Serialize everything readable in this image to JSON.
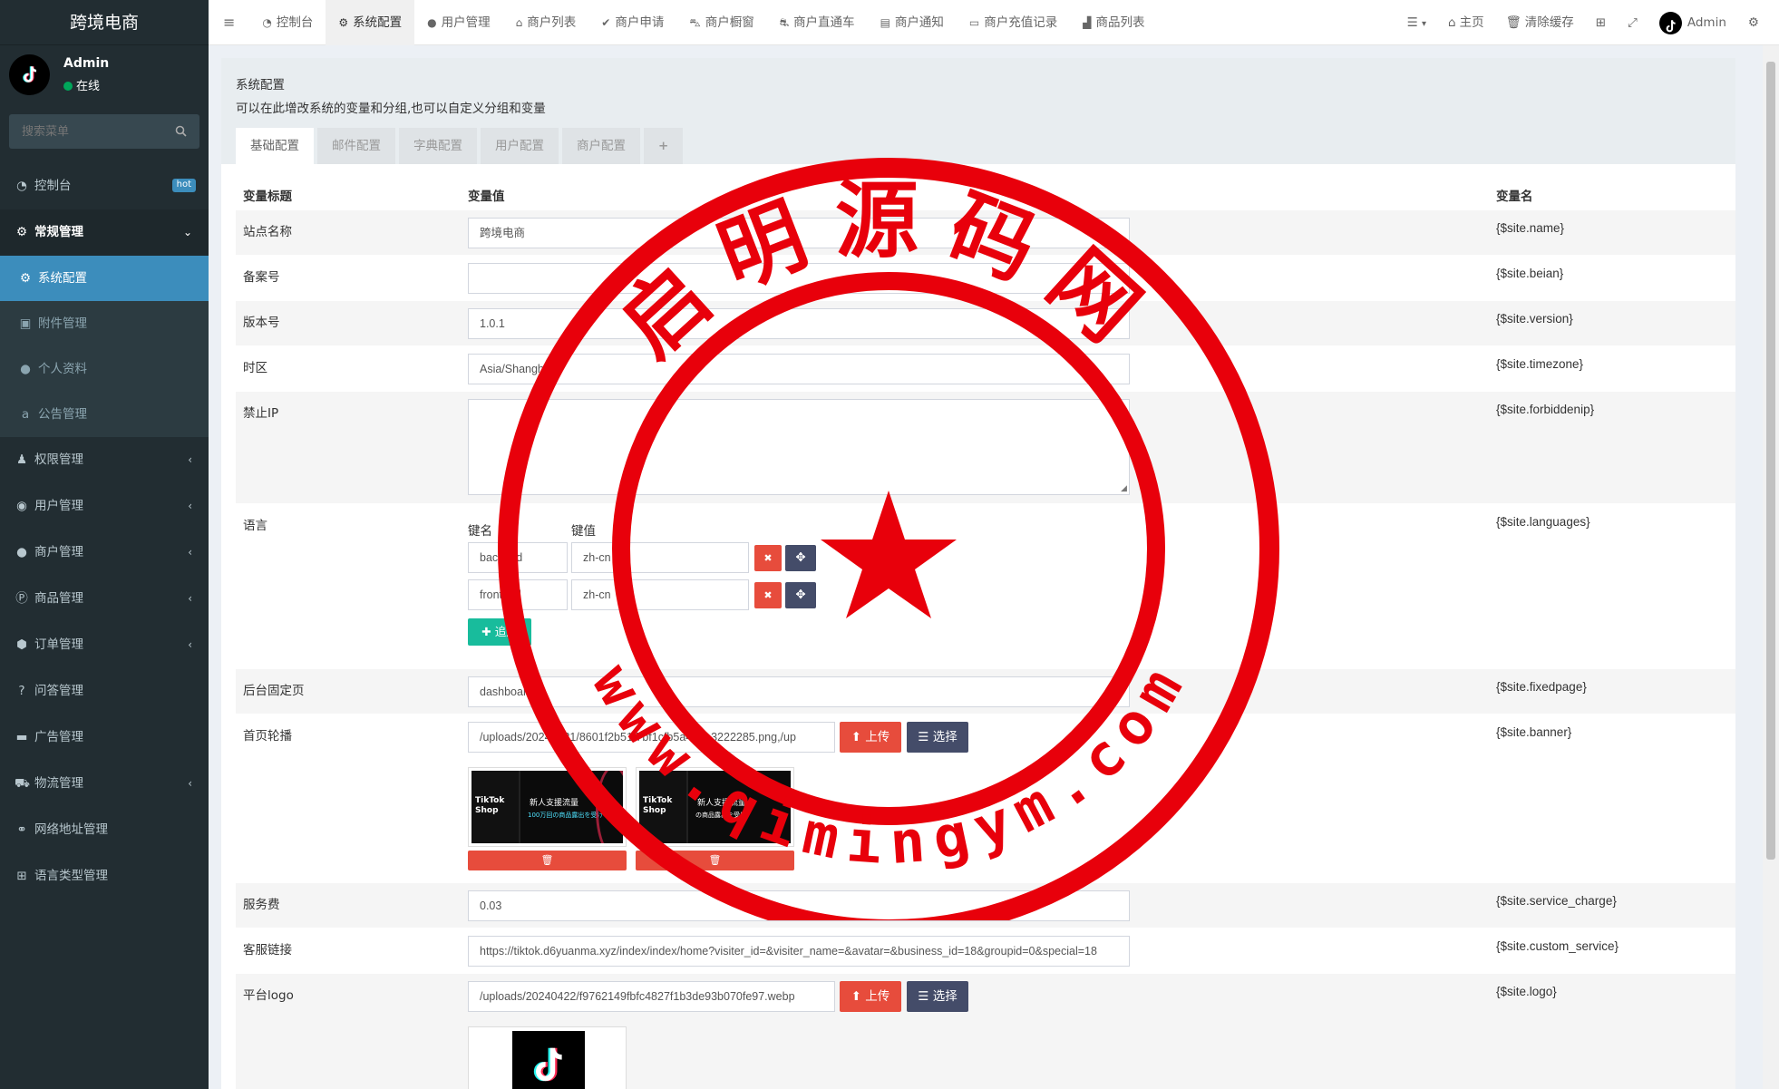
{
  "brand": "跨境电商",
  "user": {
    "name": "Admin",
    "status": "在线"
  },
  "sidebar": {
    "search_placeholder": "搜索菜单",
    "items": [
      {
        "label": "控制台",
        "badge": "hot"
      },
      {
        "label": "常规管理"
      },
      {
        "label": "系统配置"
      },
      {
        "label": "附件管理"
      },
      {
        "label": "个人资料"
      },
      {
        "label": "公告管理"
      },
      {
        "label": "权限管理"
      },
      {
        "label": "用户管理"
      },
      {
        "label": "商户管理"
      },
      {
        "label": "商品管理"
      },
      {
        "label": "订单管理"
      },
      {
        "label": "问答管理"
      },
      {
        "label": "广告管理"
      },
      {
        "label": "物流管理"
      },
      {
        "label": "网络地址管理"
      },
      {
        "label": "语言类型管理"
      }
    ]
  },
  "topbar": {
    "tabs": [
      "控制台",
      "系统配置",
      "用户管理",
      "商户列表",
      "商户申请",
      "商户橱窗",
      "商户直通车",
      "商户通知",
      "商户充值记录",
      "商品列表"
    ],
    "right": {
      "home": "主页",
      "clear_cache": "清除缓存",
      "admin": "Admin"
    }
  },
  "panel": {
    "title": "系统配置",
    "desc": "可以在此增改系统的变量和分组,也可以自定义分组和变量",
    "tabs": [
      "基础配置",
      "邮件配置",
      "字典配置",
      "用户配置",
      "商户配置",
      "+"
    ]
  },
  "table": {
    "headers": {
      "title": "变量标题",
      "value": "变量值",
      "name": "变量名"
    },
    "rows": {
      "site_name": {
        "title": "站点名称",
        "value": "跨境电商",
        "var": "{$site.name}"
      },
      "beian": {
        "title": "备案号",
        "value": "",
        "var": "{$site.beian}"
      },
      "version": {
        "title": "版本号",
        "value": "1.0.1",
        "var": "{$site.version}"
      },
      "timezone": {
        "title": "时区",
        "value": "Asia/Shanghai",
        "var": "{$site.timezone}"
      },
      "forbiddenip": {
        "title": "禁止IP",
        "value": "",
        "var": "{$site.forbiddenip}"
      },
      "languages": {
        "title": "语言",
        "var": "{$site.languages}",
        "key_header": "键名",
        "val_header": "键值",
        "pairs": [
          {
            "key": "backend",
            "val": "zh-cn"
          },
          {
            "key": "frontend",
            "val": "zh-cn"
          }
        ],
        "add_label": "追加"
      },
      "fixedpage": {
        "title": "后台固定页",
        "value": "dashboard",
        "var": "{$site.fixedpage}"
      },
      "banner": {
        "title": "首页轮播",
        "value": "/uploads/20240421/8601f2b51f7bf1cfb5a475a3222285.png,/up",
        "var": "{$site.banner}",
        "upload_label": "上传",
        "choose_label": "选择"
      },
      "service_charge": {
        "title": "服务费",
        "value": "0.03",
        "var": "{$site.service_charge}"
      },
      "custom_service": {
        "title": "客服链接",
        "value": "https://tiktok.d6yuanma.xyz/index/index/home?visiter_id=&visiter_name=&avatar=&business_id=18&groupid=0&special=18",
        "var": "{$site.custom_service}"
      },
      "logo": {
        "title": "平台logo",
        "value": "/uploads/20240422/f9762149fbfc4827f1b3de93b070fe97.webp",
        "var": "{$site.logo}",
        "upload_label": "上传",
        "choose_label": "选择"
      }
    }
  },
  "banner_thumbs": [
    {
      "brand": "TikTok Shop",
      "headline": "新人支援流量",
      "sub": "100万回の商品露出を受け"
    },
    {
      "brand": "TikTok Shop",
      "headline": "新人支援流量",
      "sub": "の商品露出を受け"
    }
  ],
  "watermark": {
    "top_text": "启明源码网",
    "bottom_text": "www.qimingym.com"
  },
  "colors": {
    "sidebar": "#222d32",
    "active": "#3c8dbc",
    "danger": "#e74c3c",
    "navy": "#444c69",
    "success": "#18bc9c",
    "stamp": "#e8000b"
  }
}
